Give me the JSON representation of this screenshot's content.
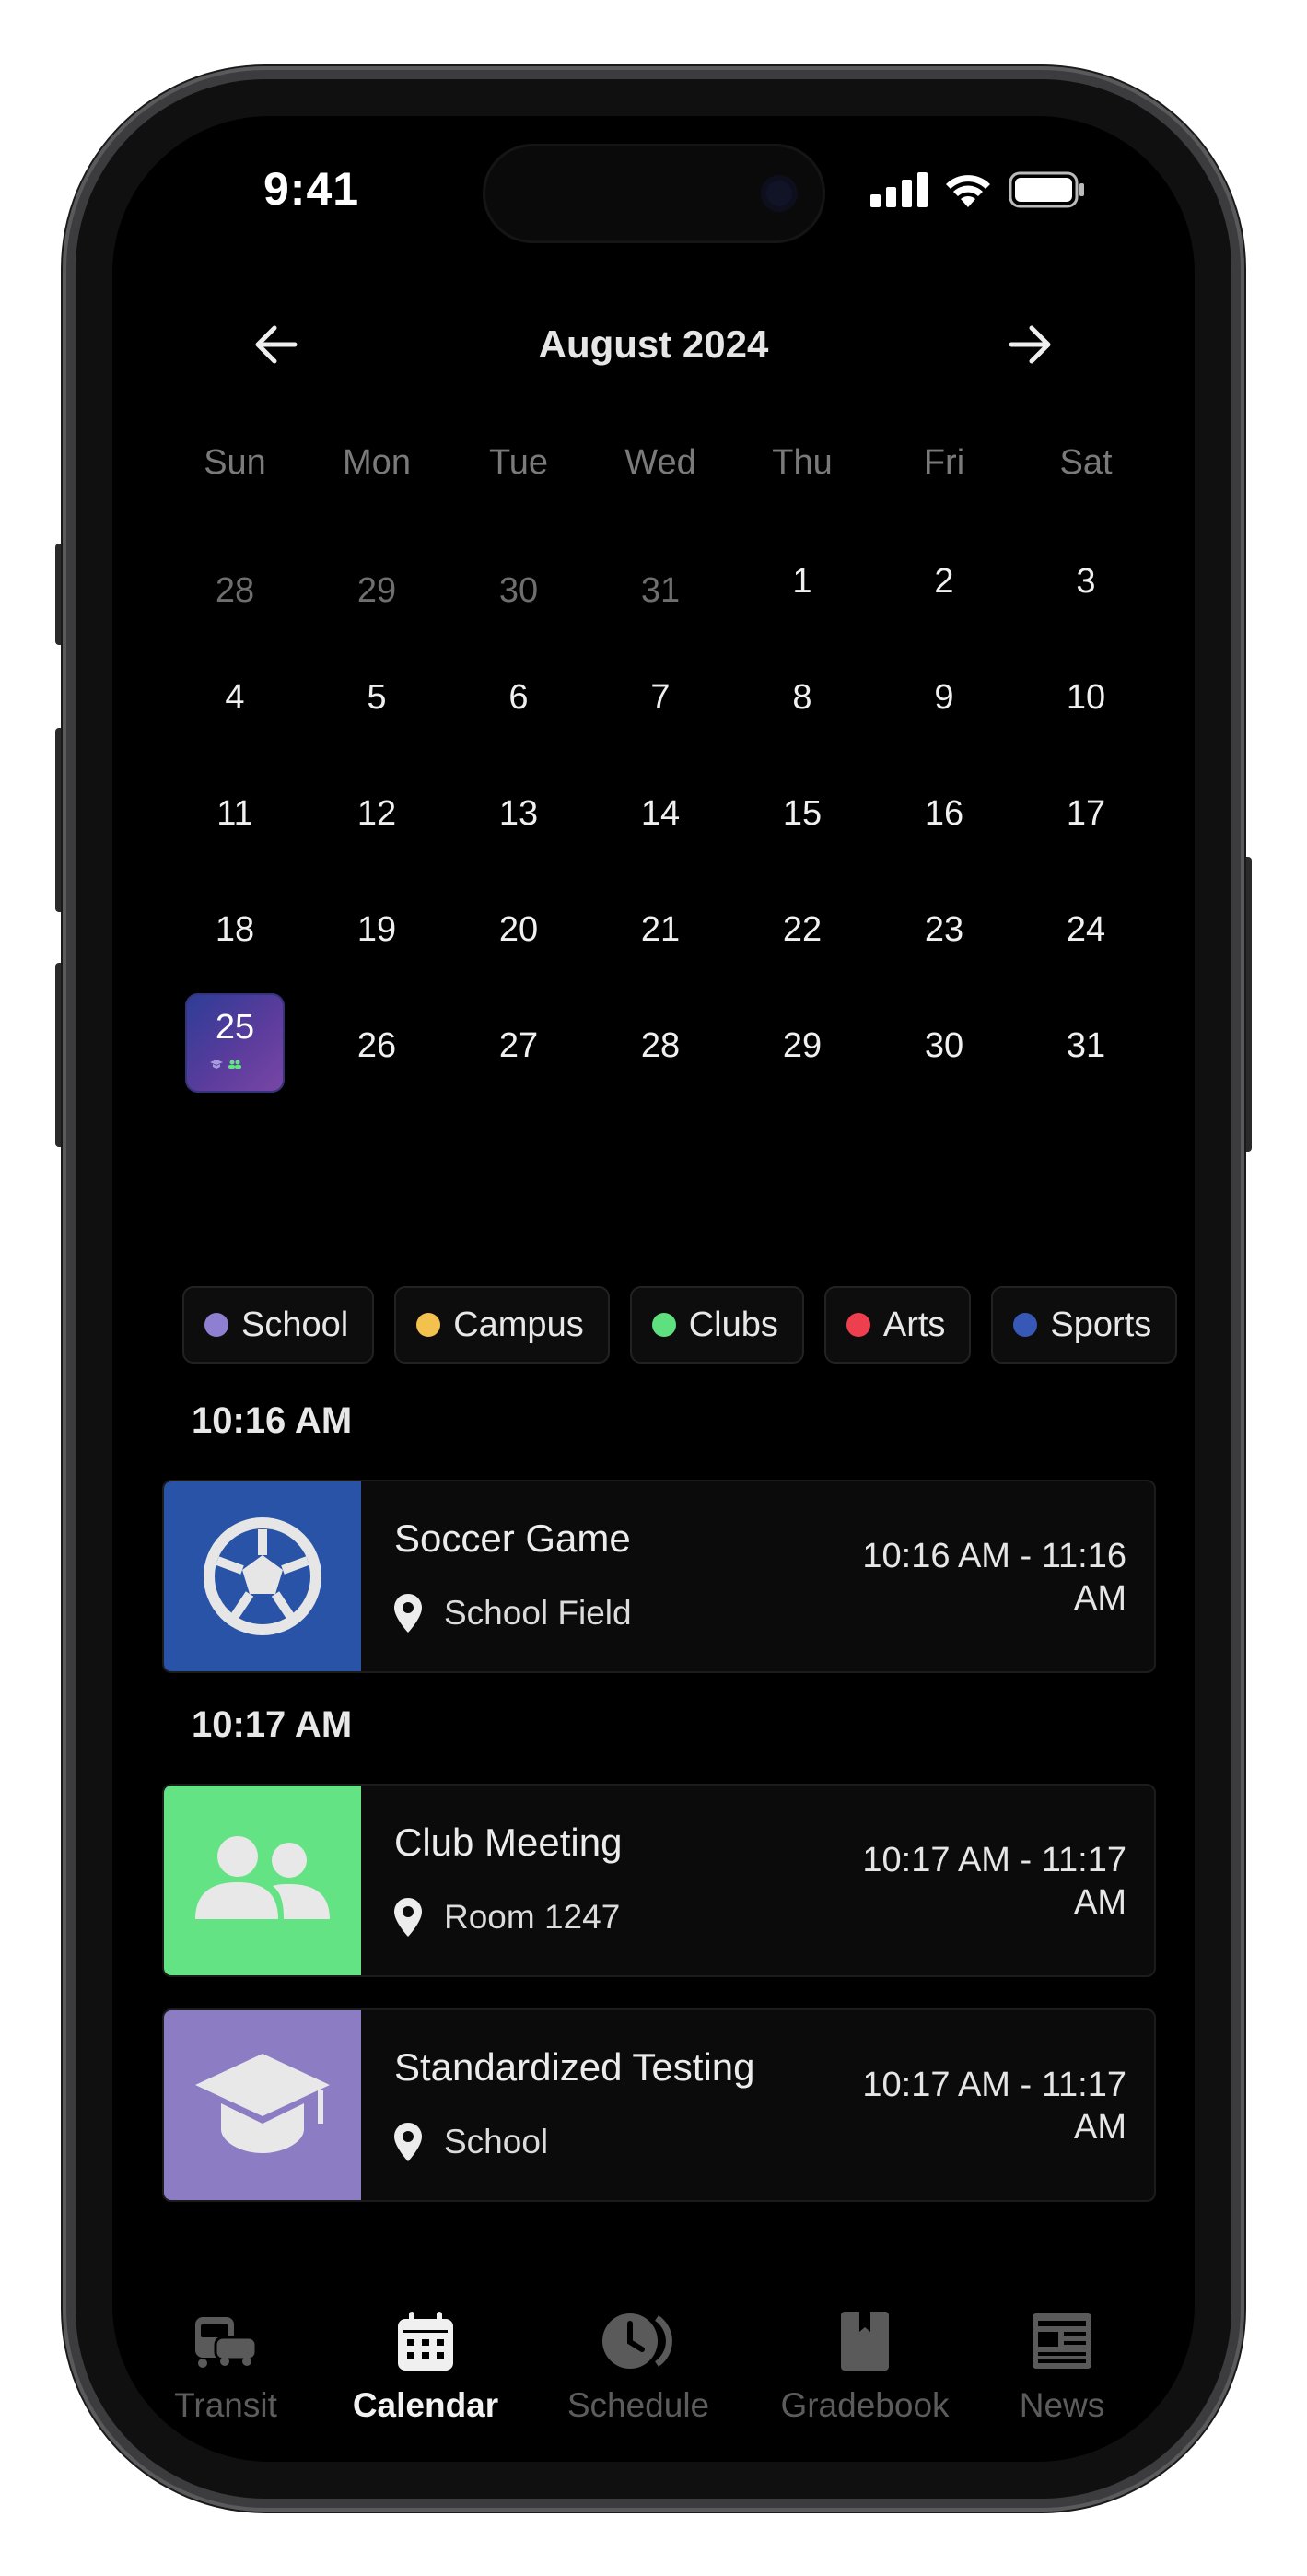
{
  "status_bar": {
    "time": "9:41"
  },
  "calendar": {
    "month_label": "August 2024",
    "weekdays": [
      "Sun",
      "Mon",
      "Tue",
      "Wed",
      "Thu",
      "Fri",
      "Sat"
    ],
    "weeks": [
      [
        "28",
        "29",
        "30",
        "31",
        "1",
        "2",
        "3"
      ],
      [
        "4",
        "5",
        "6",
        "7",
        "8",
        "9",
        "10"
      ],
      [
        "11",
        "12",
        "13",
        "14",
        "15",
        "16",
        "17"
      ],
      [
        "18",
        "19",
        "20",
        "21",
        "22",
        "23",
        "24"
      ],
      [
        "25",
        "26",
        "27",
        "28",
        "29",
        "30",
        "31"
      ]
    ],
    "selected_day": "25"
  },
  "filters": [
    {
      "label": "School",
      "color": "#8f7fd0"
    },
    {
      "label": "Campus",
      "color": "#f2c14e"
    },
    {
      "label": "Clubs",
      "color": "#5fe07f"
    },
    {
      "label": "Arts",
      "color": "#ee3f4f"
    },
    {
      "label": "Sports",
      "color": "#3858b8"
    }
  ],
  "groups": [
    {
      "time": "10:16 AM",
      "events": [
        {
          "title": "Soccer Game",
          "location": "School Field",
          "range_line1": "10:16 AM - 11:16",
          "range_line2": "AM",
          "color": "#2953a6",
          "icon": "soccer-ball-icon"
        }
      ]
    },
    {
      "time": "10:17 AM",
      "events": [
        {
          "title": "Club Meeting",
          "location": "Room 1247",
          "range_line1": "10:17 AM - 11:17",
          "range_line2": "AM",
          "color": "#63e384",
          "icon": "people-icon"
        },
        {
          "title": "Standardized Testing",
          "location": "School",
          "range_line1": "10:17 AM - 11:17",
          "range_line2": "AM",
          "color": "#8b7cc4",
          "icon": "graduation-cap-icon"
        }
      ]
    }
  ],
  "tabs": [
    {
      "label": "Transit",
      "icon": "bus-car-icon",
      "active": false
    },
    {
      "label": "Calendar",
      "icon": "calendar-icon",
      "active": true
    },
    {
      "label": "Schedule",
      "icon": "schedule-clock-icon",
      "active": false
    },
    {
      "label": "Gradebook",
      "icon": "bookmark-book-icon",
      "active": false
    },
    {
      "label": "News",
      "icon": "newspaper-icon",
      "active": false
    }
  ]
}
